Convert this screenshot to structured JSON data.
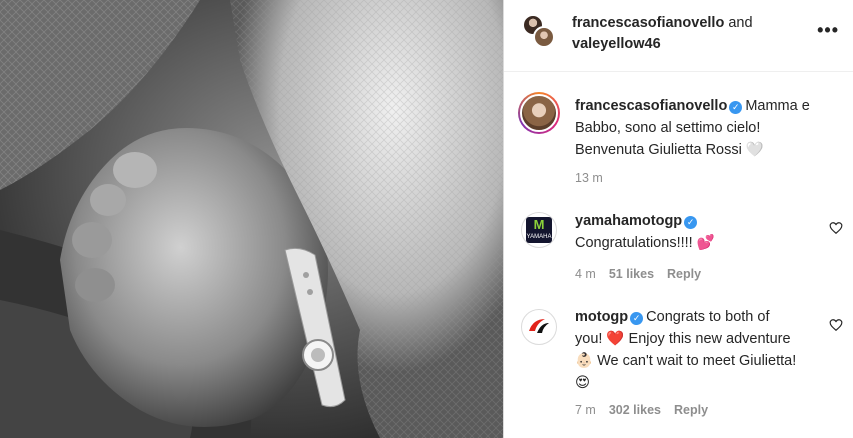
{
  "header": {
    "user1": "francescasofianovello",
    "conjunction": "and",
    "user2": "valeyellow46",
    "more_label": "•••"
  },
  "caption": {
    "username": "francescasofianovello",
    "verified_icon": "verified-badge-icon",
    "text_line1": "Mamma e",
    "text_line2": "Babbo, sono al settimo cielo!",
    "text_line3": "Benvenuta Giulietta Rossi 🤍",
    "time": "13 m"
  },
  "comments": [
    {
      "username": "yamahamotogp",
      "text": "Congratulations!!!! 💕",
      "time": "4 m",
      "likes": "51 likes",
      "reply": "Reply"
    },
    {
      "username": "motogp",
      "text_line1": "Congrats to both of",
      "text_line2": "you! ❤️ Enjoy this new adventure",
      "text_line3": "👶🏻 We can't wait to meet Giulietta!",
      "text_line4": "😍",
      "time": "7 m",
      "likes": "302 likes",
      "reply": "Reply"
    }
  ],
  "colors": {
    "verified": "#3897f0",
    "muted_text": "#8e8e8e",
    "text": "#262626"
  }
}
